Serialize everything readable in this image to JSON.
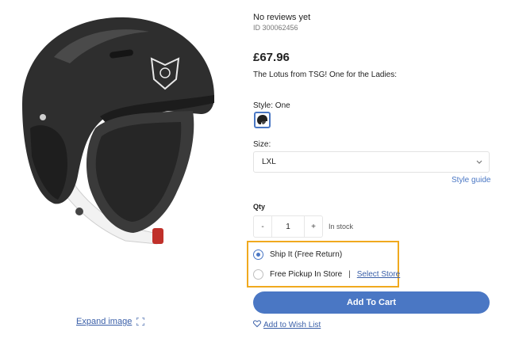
{
  "product": {
    "reviews": "No reviews yet",
    "id": "ID 300062456",
    "price": "£67.96",
    "description": "The Lotus from TSG! One for the Ladies:"
  },
  "style": {
    "label": "Style: One"
  },
  "size": {
    "label": "Size:",
    "selected": "LXL",
    "guide_label": "Style guide"
  },
  "quantity": {
    "label": "Qty",
    "minus": "-",
    "value": "1",
    "plus": "+",
    "stock": "In stock"
  },
  "delivery": {
    "ship_label": "Ship It (Free Return)",
    "pickup_label": "Free Pickup In Store",
    "separator": "|",
    "select_store": "Select Store"
  },
  "actions": {
    "add_to_cart": "Add To Cart",
    "wishlist": "Add to Wish List"
  },
  "image": {
    "expand_label": "Expand image"
  },
  "colors": {
    "accent": "#4a77c4",
    "highlight_border": "#f0a91e"
  },
  "icons": {
    "expand": "expand-icon",
    "heart": "heart-icon",
    "chevron": "chevron-down-icon"
  }
}
